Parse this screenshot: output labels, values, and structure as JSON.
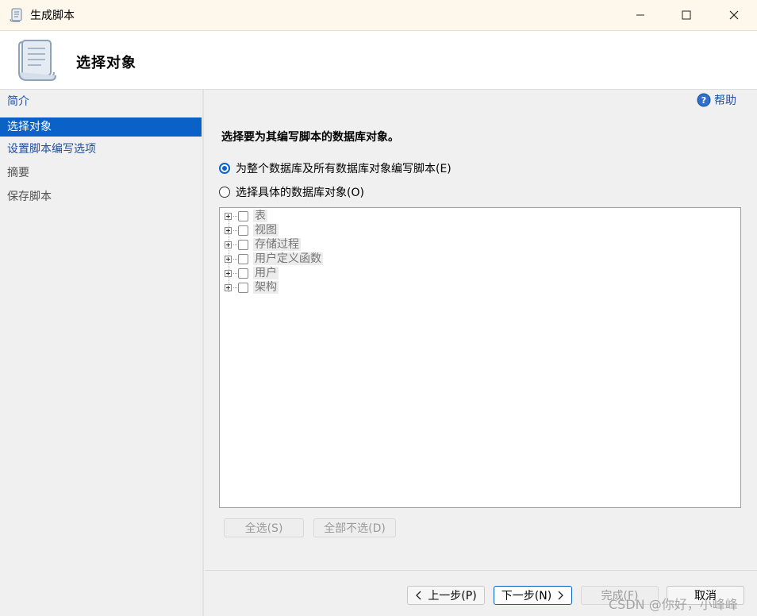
{
  "window": {
    "title": "生成脚本"
  },
  "header": {
    "title": "选择对象"
  },
  "sidebar": {
    "items": [
      {
        "label": "简介",
        "state": "link"
      },
      {
        "label": "选择对象",
        "state": "active"
      },
      {
        "label": "设置脚本编写选项",
        "state": "link"
      },
      {
        "label": "摘要",
        "state": "disabled"
      },
      {
        "label": "保存脚本",
        "state": "disabled"
      }
    ]
  },
  "main": {
    "help_label": "帮助",
    "instruction": "选择要为其编写脚本的数据库对象。",
    "radio_entire": "为整个数据库及所有数据库对象编写脚本(E)",
    "radio_specific": "选择具体的数据库对象(O)",
    "tree_items": [
      "表",
      "视图",
      "存储过程",
      "用户定义函数",
      "用户",
      "架构"
    ],
    "select_all": "全选(S)",
    "deselect_all": "全部不选(D)"
  },
  "footer": {
    "prev": "上一步(P)",
    "next": "下一步(N)",
    "finish": "完成(F)",
    "cancel": "取消"
  },
  "watermark": "CSDN @你好，小峰峰",
  "colors": {
    "accent": "#0a62c9",
    "link": "#1f4fa0",
    "titlebar": "#fdf7ec"
  }
}
